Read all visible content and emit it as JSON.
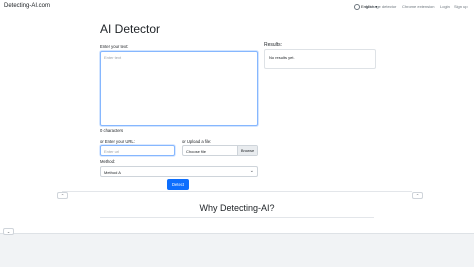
{
  "header": {
    "brand": "Detecting-AI.com",
    "language": "English",
    "language_caret": "▾",
    "nav": [
      "AI image detector",
      "Chrome extension",
      "Login",
      "Sign up"
    ]
  },
  "main": {
    "title": "AI Detector",
    "text_label": "Enter your text:",
    "text_placeholder": "Enter text",
    "char_count": "0 characters",
    "url_label": "or Enter your URL:",
    "url_placeholder": "Enter url",
    "file_label": "or Upload a file:",
    "file_button": "Choose file",
    "browse_label": "Browse",
    "method_label": "Method:",
    "method_value": "Method A",
    "detect_button": "Detect"
  },
  "results": {
    "label": "Results:",
    "empty_text": "No results yet."
  },
  "section": {
    "title": "Why Detecting-AI?"
  },
  "colors": {
    "primary": "#0d6efd",
    "focus_border": "#86b7fe",
    "muted": "#6c757d"
  },
  "icons": {
    "collapse_up": "chevron-up-icon",
    "collapse_down": "chevron-down-icon",
    "language": "globe-icon"
  }
}
